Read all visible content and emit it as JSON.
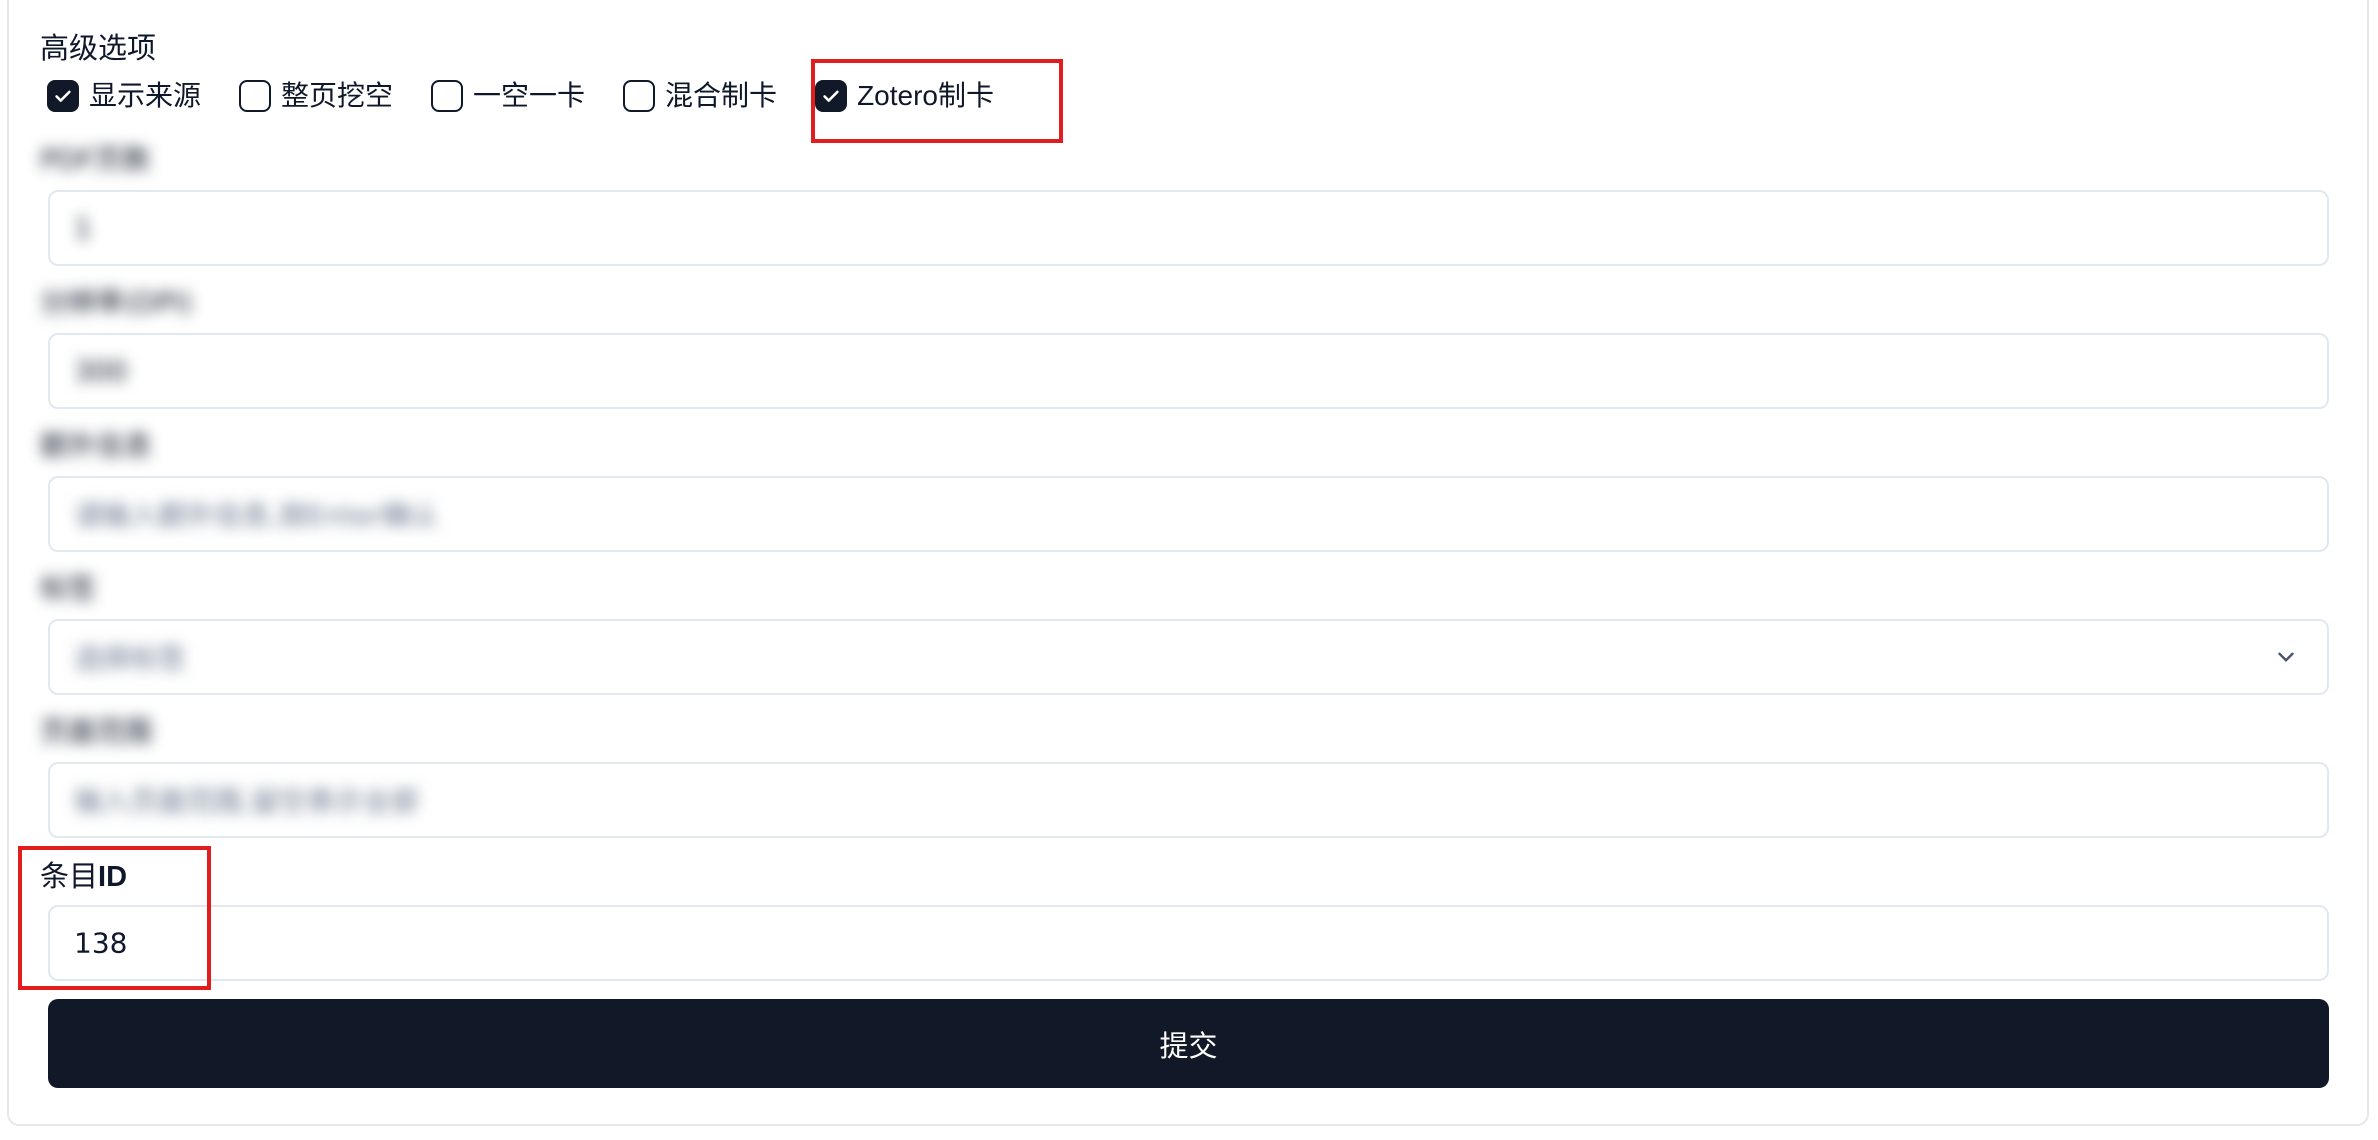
{
  "advanced": {
    "title": "高级选项",
    "options": [
      {
        "label": "显示来源",
        "checked": true
      },
      {
        "label": "整页挖空",
        "checked": false
      },
      {
        "label": "一空一卡",
        "checked": false
      },
      {
        "label": "混合制卡",
        "checked": false
      },
      {
        "label": "Zotero制卡",
        "checked": true
      }
    ]
  },
  "fields": {
    "pdf_pages": {
      "label": "PDF页数",
      "value": "1"
    },
    "resolution": {
      "label": "分辨率(DPI)",
      "value": "300"
    },
    "extra_info": {
      "label": "额外信息",
      "placeholder": "请输入额外信息,按Enter确认"
    },
    "tags": {
      "label": "标签",
      "placeholder": "选择标签"
    },
    "page_range": {
      "label": "页面范围",
      "placeholder": "输入页面范围,留空表示全部"
    },
    "item_id": {
      "label_prefix": "条目",
      "label_id": "ID",
      "value": "138"
    }
  },
  "submit": {
    "label": "提交"
  },
  "colors": {
    "primary": "#111827",
    "highlight": "#e11d1d",
    "border": "#e2e8f0"
  }
}
